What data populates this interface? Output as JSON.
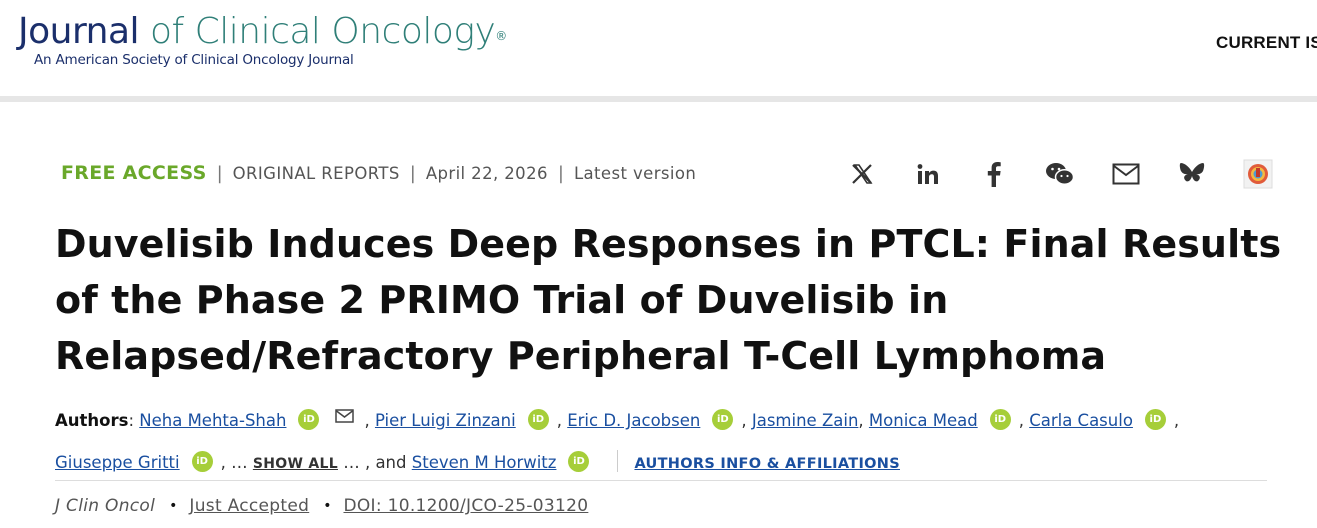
{
  "header": {
    "logo_word_journal": "Journal",
    "logo_word_rest": "of Clinical Oncology",
    "logo_registered": "®",
    "logo_subtitle": "An American Society of Clinical Oncology Journal",
    "nav_current_issue": "CURRENT IS"
  },
  "meta": {
    "access": "FREE ACCESS",
    "separator": "|",
    "section": "ORIGINAL REPORTS",
    "date": "April 22, 2026",
    "version": "Latest version"
  },
  "share_icons": [
    "x-icon",
    "linkedin-icon",
    "facebook-icon",
    "wechat-icon",
    "email-icon",
    "bluesky-icon",
    "mendeley-icon"
  ],
  "article": {
    "title": "Duvelisib Induces Deep Responses in PTCL: Final Results of the Phase 2 PRIMO Trial of Duvelisib in Relapsed/Refractory Peripheral T-Cell Lymphoma"
  },
  "authors": {
    "label": "Authors",
    "colon": ": ",
    "list": [
      "Neha Mehta-Shah",
      "Pier Luigi Zinzani",
      "Eric D. Jacobsen",
      "Jasmine Zain",
      "Monica Mead",
      "Carla Casulo",
      "Giuseppe Gritti",
      "Steven M Horwitz"
    ],
    "orcid_label": "iD",
    "comma": ", ",
    "ellipsis": ", … ",
    "show_all": "SHOW ALL",
    "ellipsis_after": " … , and ",
    "affiliations_link": "AUTHORS INFO & AFFILIATIONS"
  },
  "citation": {
    "journal": "J Clin Oncol",
    "bullet": "•",
    "status": "Just Accepted",
    "doi": "DOI: 10.1200/JCO-25-03120"
  },
  "colors": {
    "accent_green": "#6aa82a",
    "link_blue": "#1a4fa0",
    "orcid_green": "#a6ce39",
    "logo_navy": "#1b2f6b",
    "logo_teal": "#2f7f78"
  }
}
